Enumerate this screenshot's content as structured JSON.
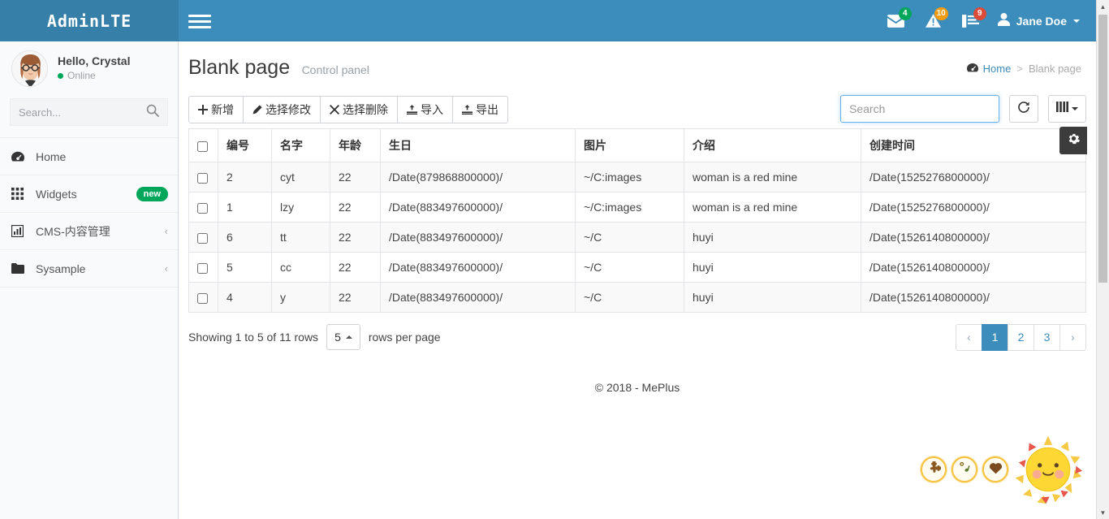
{
  "navbar": {
    "logo": "AdminLTE",
    "toggle_label": "Toggle navigation",
    "messages": {
      "icon": "envelope-icon",
      "count": "4"
    },
    "notifications": {
      "icon": "warning-icon",
      "count": "10"
    },
    "tasks": {
      "icon": "tasks-icon",
      "count": "9"
    },
    "user": {
      "name": "Jane Doe",
      "icon": "user-icon"
    }
  },
  "sidebar": {
    "user_panel": {
      "greeting": "Hello, Crystal",
      "status": "Online",
      "avatar": "avatar-image"
    },
    "search": {
      "placeholder": "Search...",
      "value": "",
      "icon": "search-icon"
    },
    "items": [
      {
        "label": "Home",
        "icon": "dashboard-icon",
        "badge": "",
        "arrow": ""
      },
      {
        "label": "Widgets",
        "icon": "grid-icon",
        "badge": "new",
        "arrow": ""
      },
      {
        "label": "CMS-内容管理",
        "icon": "bar-chart-icon",
        "badge": "",
        "arrow": "‹"
      },
      {
        "label": "Sysample",
        "icon": "folder-icon",
        "badge": "",
        "arrow": "‹"
      }
    ]
  },
  "content_header": {
    "title": "Blank page",
    "subtitle": "Control panel",
    "breadcrumb": {
      "home": "Home",
      "home_icon": "dashboard-icon",
      "separator": ">",
      "current": "Blank page"
    }
  },
  "toolbar": {
    "buttons": [
      {
        "label": "新增",
        "icon": "plus-icon"
      },
      {
        "label": "选择修改",
        "icon": "pencil-icon"
      },
      {
        "label": "选择删除",
        "icon": "times-icon"
      },
      {
        "label": "导入",
        "icon": "import-icon"
      },
      {
        "label": "导出",
        "icon": "export-icon"
      }
    ],
    "search": {
      "placeholder": "Search",
      "value": ""
    },
    "refresh": {
      "icon": "refresh-icon",
      "label": ""
    },
    "columns": {
      "icon": "columns-icon",
      "label": ""
    },
    "settings_fab": {
      "icon": "gear-icon",
      "label": ""
    }
  },
  "table": {
    "select_all": false,
    "columns": [
      "编号",
      "名字",
      "年龄",
      "生日",
      "图片",
      "介绍",
      "创建时间"
    ],
    "rows": [
      {
        "checked": false,
        "id": "2",
        "name": "cyt",
        "age": "22",
        "birthday": "/Date(879868800000)/",
        "image": "~/C:images",
        "intro": "woman is a red mine",
        "created": "/Date(1525276800000)/"
      },
      {
        "checked": false,
        "id": "1",
        "name": "lzy",
        "age": "22",
        "birthday": "/Date(883497600000)/",
        "image": "~/C:images",
        "intro": "woman is a red mine",
        "created": "/Date(1525276800000)/"
      },
      {
        "checked": false,
        "id": "6",
        "name": "tt",
        "age": "22",
        "birthday": "/Date(883497600000)/",
        "image": "~/C",
        "intro": "huyi",
        "created": "/Date(1526140800000)/"
      },
      {
        "checked": false,
        "id": "5",
        "name": "cc",
        "age": "22",
        "birthday": "/Date(883497600000)/",
        "image": "~/C",
        "intro": "huyi",
        "created": "/Date(1526140800000)/"
      },
      {
        "checked": false,
        "id": "4",
        "name": "y",
        "age": "22",
        "birthday": "/Date(883497600000)/",
        "image": "~/C",
        "intro": "huyi",
        "created": "/Date(1526140800000)/"
      }
    ]
  },
  "pager": {
    "showing": "Showing 1 to 5 of 11 rows",
    "page_size": "5",
    "rows_per_page": "rows per page",
    "prev": "‹",
    "next": "›",
    "pages": [
      "1",
      "2",
      "3"
    ],
    "active_page": "1"
  },
  "footer": {
    "text": "© 2018 - MePlus"
  },
  "mascot": {
    "orbs": [
      {
        "icon": "puzzle-icon"
      },
      {
        "icon": "music-note-icon"
      },
      {
        "icon": "heart-icon"
      }
    ],
    "sun": {
      "icon": "sun-face-icon"
    }
  },
  "colors": {
    "navbar": "#3c8dbc",
    "logo_bg": "#367fa9",
    "accent": "#3c8dbc",
    "badge_green": "#00a65a",
    "badge_yellow": "#f39c12",
    "badge_red": "#dd4b39",
    "sun": "#fdd835"
  }
}
